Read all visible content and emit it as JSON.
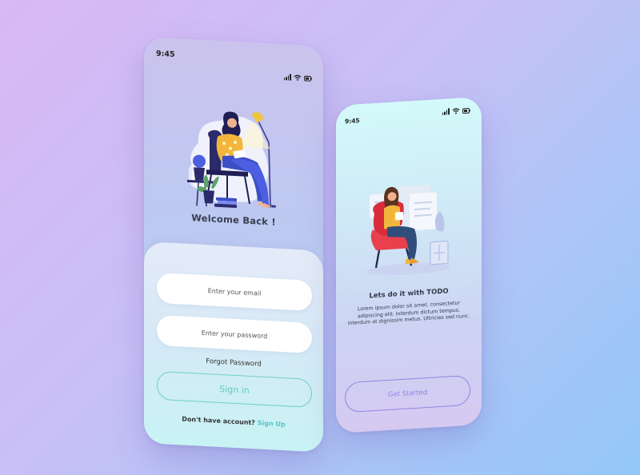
{
  "login_screen": {
    "status_time": "9:45",
    "welcome_title": "Welcome Back !",
    "email_placeholder": "Enter your email",
    "password_placeholder": "Enter your password",
    "forgot_password": "Forgot Password",
    "sign_in_label": "Sign in",
    "no_account_text": "Don't have account?",
    "sign_up_label": "Sign Up",
    "icons": [
      "signal-icon",
      "wifi-icon",
      "battery-icon",
      "reading-woman-illustration"
    ]
  },
  "onboarding_screen": {
    "status_time": "9:45",
    "title": "Lets do it with TODO",
    "description": "Lorem ipsum dolor sit amet, consectetur adipiscing elit. Interdum dictum tempus, interdum at dignissim metus. Ultricies sed nunc.",
    "get_started_label": "Get Started",
    "icons": [
      "signal-icon",
      "wifi-icon",
      "battery-icon",
      "armchair-woman-illustration"
    ]
  },
  "colors": {
    "accent_teal": "#63cbb9",
    "accent_purple": "#8f86e4",
    "text_dark": "#333a4a"
  }
}
